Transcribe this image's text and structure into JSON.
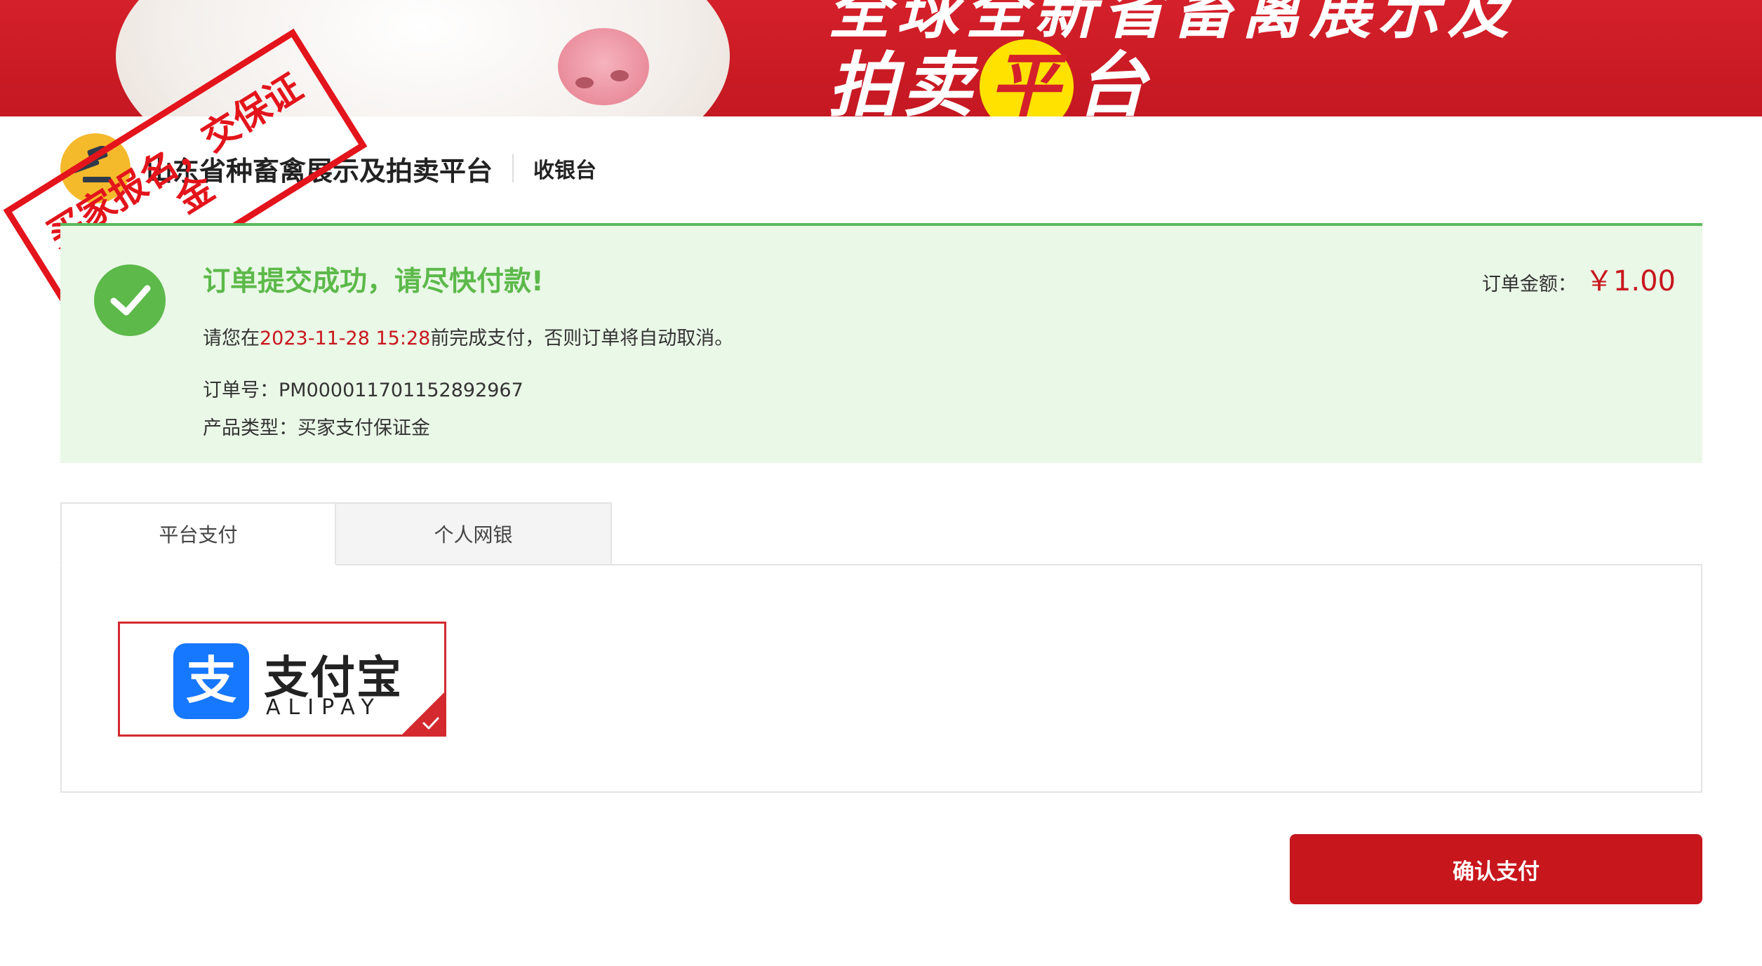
{
  "banner": {
    "slogan_top": "全球全新省畜禽展示及",
    "slogan_part1": "拍卖",
    "slogan_ring": "平",
    "slogan_part2": "台"
  },
  "header": {
    "site_name": "山东省种畜禽展示及拍卖平台",
    "cashier_label": "收银台"
  },
  "stamp": {
    "line1": "买家报名，交保证",
    "line2": "金"
  },
  "order": {
    "title": "订单提交成功，请尽快付款!",
    "deadline_prefix": "请您在",
    "deadline": "2023-11-28 15:28",
    "deadline_suffix": "前完成支付，否则订单将自动取消。",
    "order_no_label": "订单号：",
    "order_no": "PM000011701152892967",
    "product_type_label": "产品类型：",
    "product_type": "买家支付保证金",
    "amount_label": "订单金额：",
    "amount": "￥1.00"
  },
  "tabs": [
    {
      "label": "平台支付",
      "active": true
    },
    {
      "label": "个人网银",
      "active": false
    }
  ],
  "payment": {
    "method_cn": "支付宝",
    "method_en": "ALIPAY",
    "selected": true
  },
  "actions": {
    "confirm_label": "确认支付"
  },
  "colors": {
    "brand_red": "#c8161d",
    "success_green": "#5cb94a",
    "success_bg": "#eaf8e7",
    "alipay_blue": "#1677ff"
  }
}
